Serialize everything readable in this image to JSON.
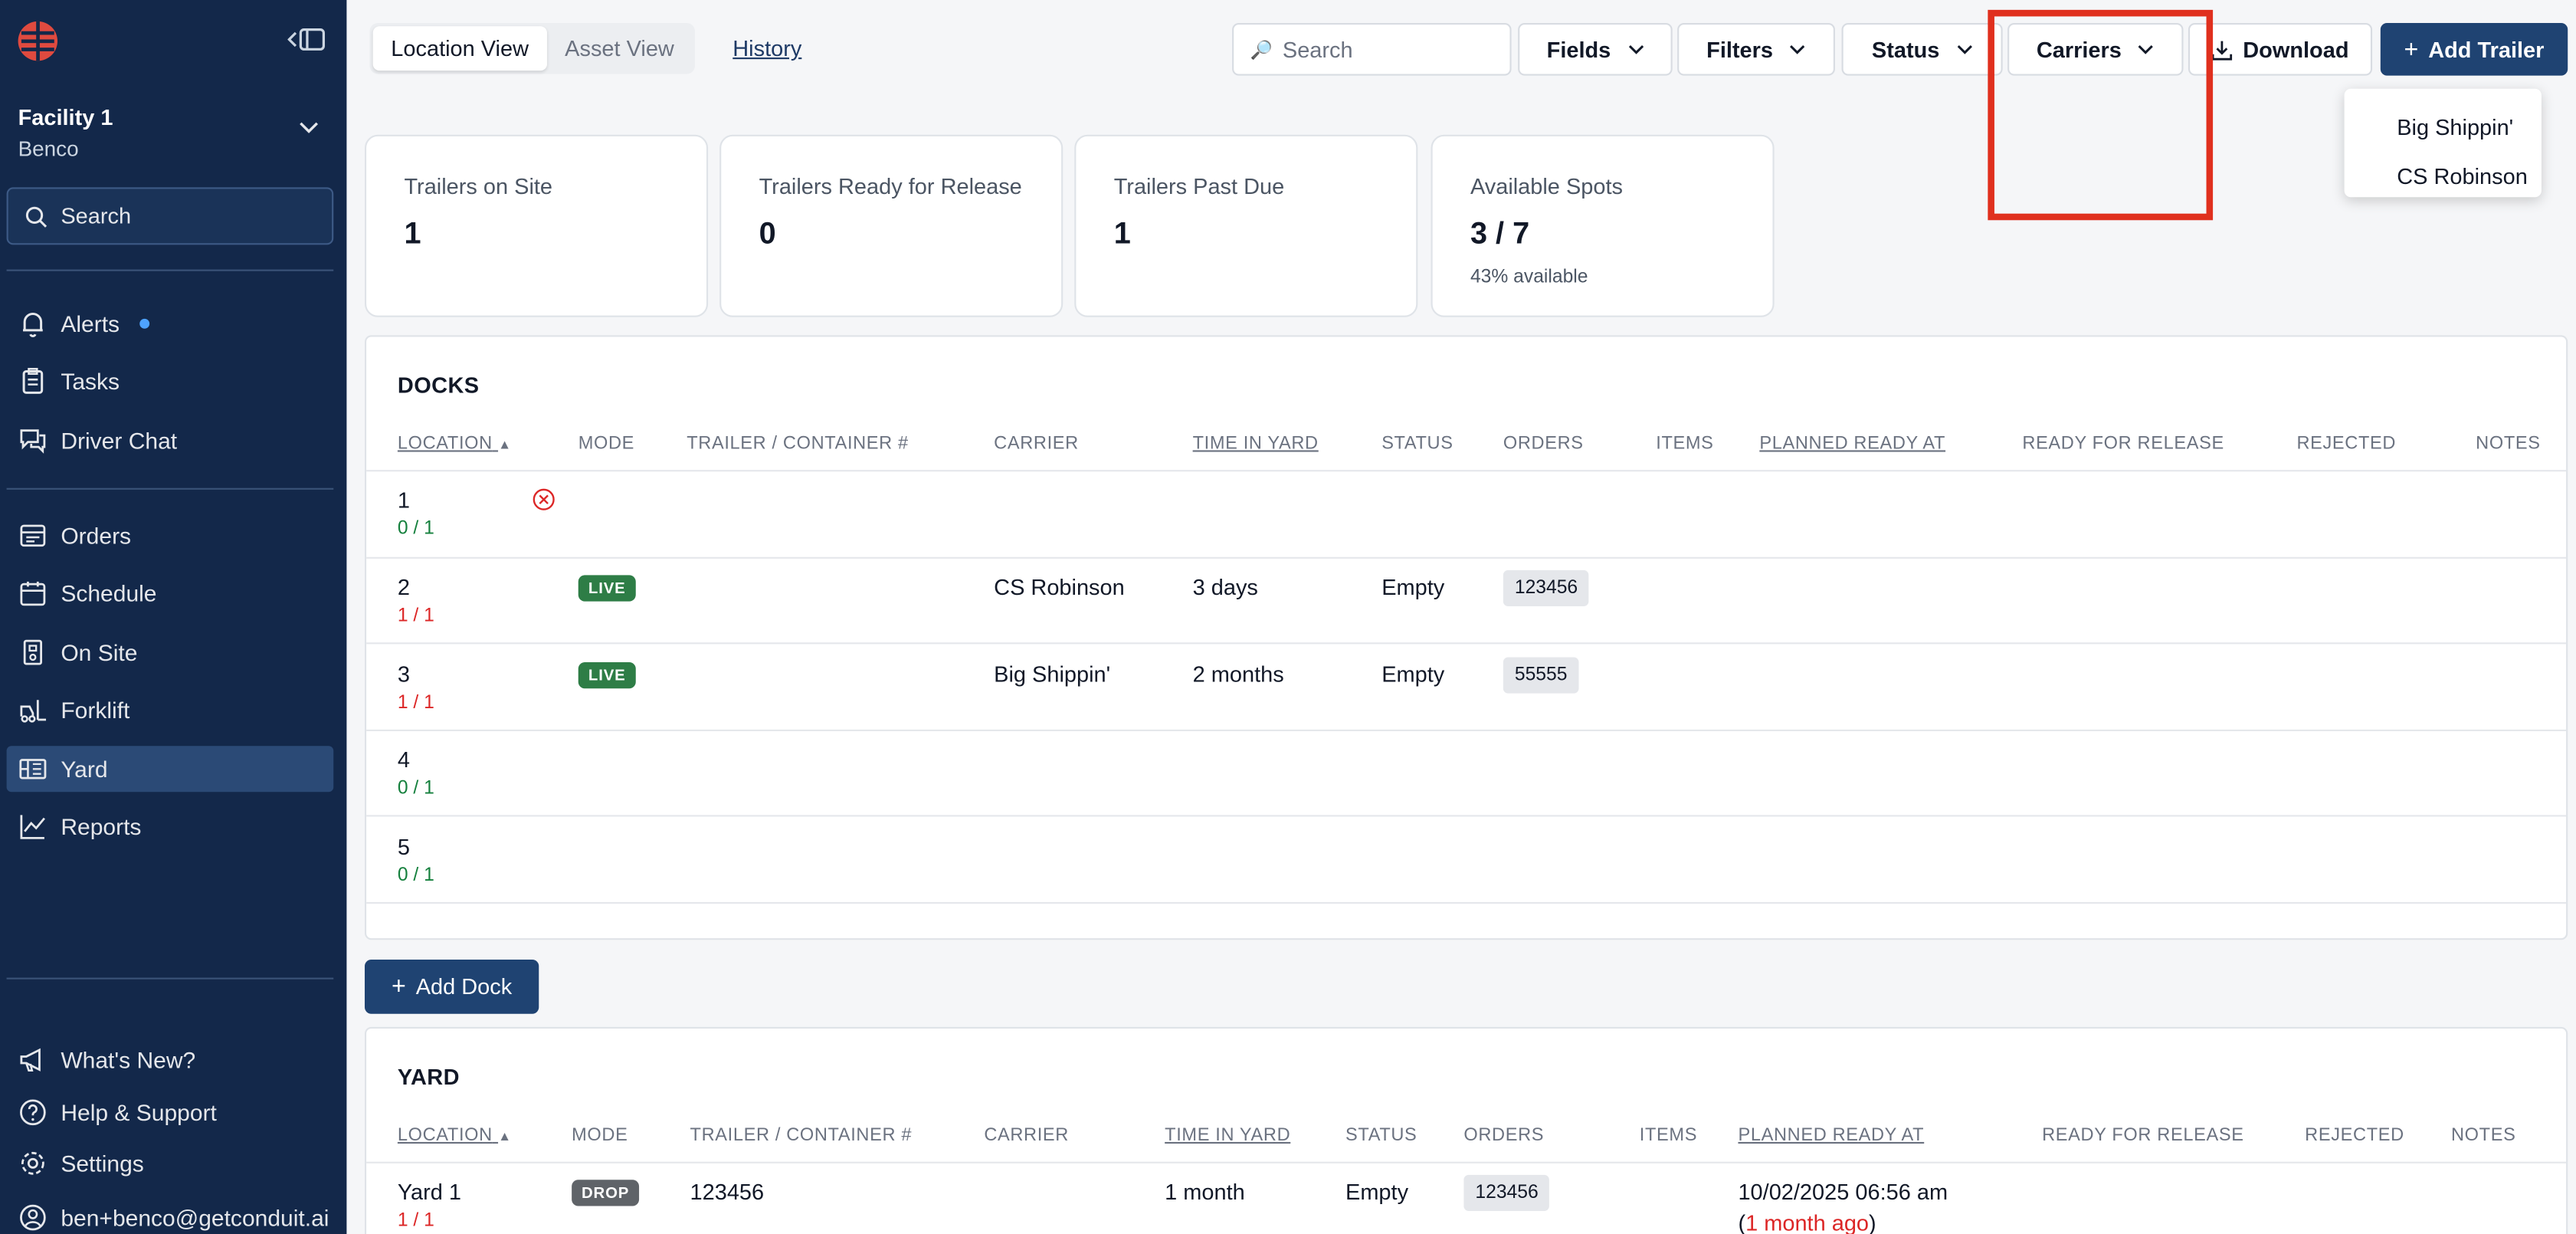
{
  "sidebar": {
    "facility_name": "Facility 1",
    "facility_org": "Benco",
    "search_label": "Search",
    "nav": [
      {
        "label": "Alerts",
        "icon": "bell-icon"
      },
      {
        "label": "Tasks",
        "icon": "clipboard-icon"
      },
      {
        "label": "Driver Chat",
        "icon": "chat-icon"
      },
      {
        "label": "Orders",
        "icon": "orders-icon"
      },
      {
        "label": "Schedule",
        "icon": "calendar-icon"
      },
      {
        "label": "On Site",
        "icon": "building-icon"
      },
      {
        "label": "Forklift",
        "icon": "forklift-icon"
      },
      {
        "label": "Yard",
        "icon": "yard-icon",
        "active": true
      },
      {
        "label": "Reports",
        "icon": "chart-line-icon"
      }
    ],
    "footer": [
      {
        "label": "What's New?",
        "icon": "megaphone-icon"
      },
      {
        "label": "Help & Support",
        "icon": "help-icon"
      },
      {
        "label": "Settings",
        "icon": "gear-icon"
      },
      {
        "label": "ben+benco@getconduit.ai",
        "icon": "user-icon"
      }
    ]
  },
  "toolbar": {
    "view_location": "Location View",
    "view_asset": "Asset View",
    "history": "History",
    "search_placeholder": "Search",
    "fields": "Fields",
    "filters": "Filters",
    "status": "Status",
    "carriers": "Carriers",
    "download": "Download",
    "add_trailer": "Add Trailer"
  },
  "carriers_dropdown": [
    "Big Shippin'",
    "CS Robinson"
  ],
  "stats": [
    {
      "label": "Trailers on Site",
      "value": "1"
    },
    {
      "label": "Trailers Ready for Release",
      "value": "0"
    },
    {
      "label": "Trailers Past Due",
      "value": "1"
    },
    {
      "label": "Available Spots",
      "value": "3 / 7",
      "sub": "43% available"
    }
  ],
  "docks": {
    "title": "DOCKS",
    "headers": [
      "LOCATION",
      "MODE",
      "TRAILER / CONTAINER #",
      "CARRIER",
      "TIME IN YARD",
      "STATUS",
      "ORDERS",
      "ITEMS",
      "PLANNED READY AT",
      "READY FOR RELEASE",
      "REJECTED",
      "NOTES"
    ],
    "rows": [
      {
        "location": "1",
        "occupancy": "0 / 1",
        "mode": "",
        "trailer": "",
        "carrier": "",
        "time": "",
        "status": "",
        "order": ""
      },
      {
        "location": "2",
        "occupancy": "1 / 1",
        "mode": "LIVE",
        "trailer": "",
        "carrier": "CS Robinson",
        "time": "3 days",
        "status": "Empty",
        "order": "123456"
      },
      {
        "location": "3",
        "occupancy": "1 / 1",
        "mode": "LIVE",
        "trailer": "",
        "carrier": "Big Shippin'",
        "time": "2 months",
        "status": "Empty",
        "order": "55555"
      },
      {
        "location": "4",
        "occupancy": "0 / 1",
        "mode": "",
        "trailer": "",
        "carrier": "",
        "time": "",
        "status": "",
        "order": ""
      },
      {
        "location": "5",
        "occupancy": "0 / 1",
        "mode": "",
        "trailer": "",
        "carrier": "",
        "time": "",
        "status": "",
        "order": ""
      }
    ],
    "add_label": "Add Dock"
  },
  "yard": {
    "title": "YARD",
    "headers": [
      "LOCATION",
      "MODE",
      "TRAILER / CONTAINER #",
      "CARRIER",
      "TIME IN YARD",
      "STATUS",
      "ORDERS",
      "ITEMS",
      "PLANNED READY AT",
      "READY FOR RELEASE",
      "REJECTED",
      "NOTES"
    ],
    "rows": [
      {
        "location": "Yard 1",
        "occupancy": "1 / 1",
        "mode": "DROP",
        "trailer": "123456",
        "carrier": "",
        "time": "1 month",
        "status": "Empty",
        "order": "123456",
        "planned": "10/02/2025 06:56 am",
        "planned_open": "(",
        "planned_rel": "1 month ago",
        "planned_close": ")"
      }
    ]
  },
  "colors": {
    "sidebar": "#13284a",
    "primary": "#1f4372",
    "live": "#2e7d46",
    "highlight": "#e0301e"
  }
}
